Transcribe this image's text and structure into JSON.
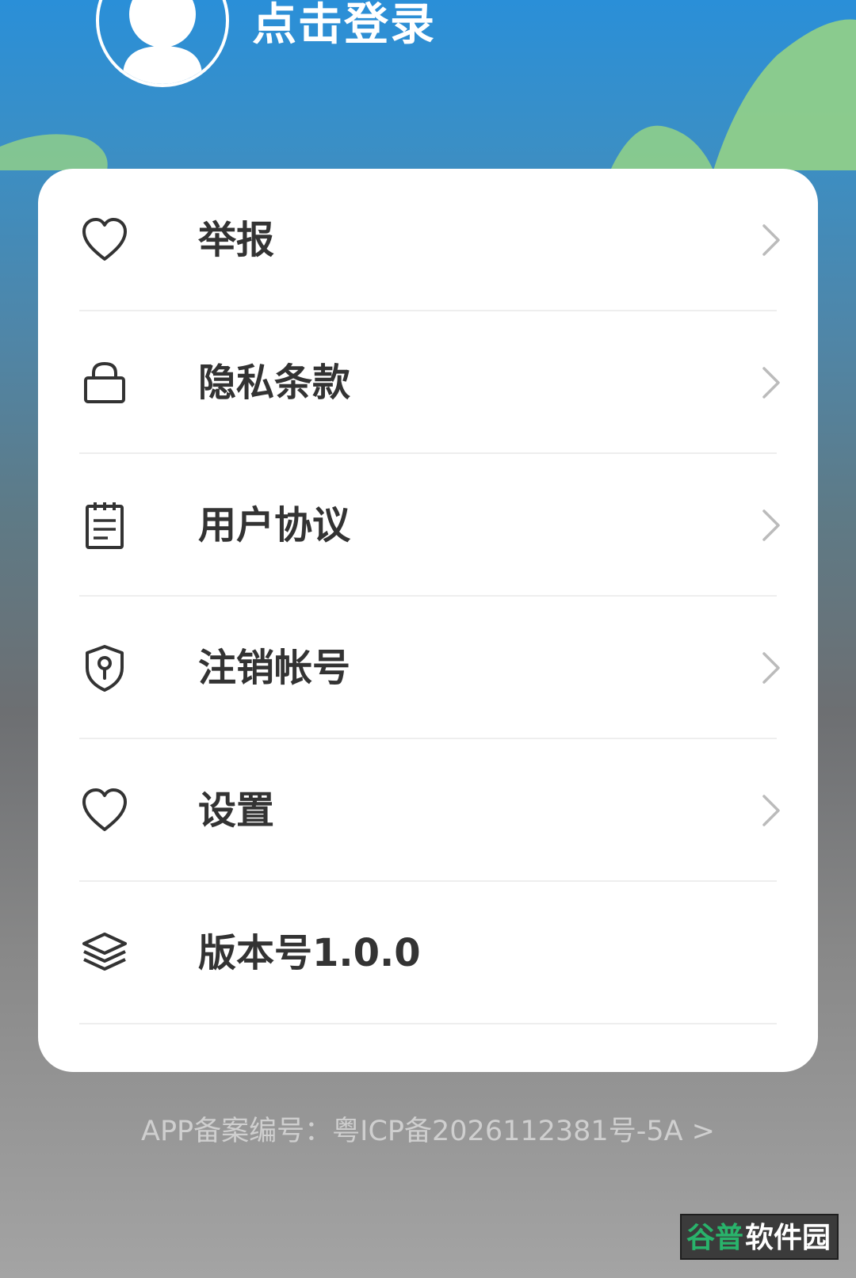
{
  "header": {
    "login_label": "点击登录"
  },
  "menu": {
    "items": [
      {
        "label": "举报",
        "icon": "heart-icon",
        "has_chevron": true
      },
      {
        "label": "隐私条款",
        "icon": "lock-icon",
        "has_chevron": true
      },
      {
        "label": "用户协议",
        "icon": "notepad-icon",
        "has_chevron": true
      },
      {
        "label": "注销帐号",
        "icon": "shield-keyhole-icon",
        "has_chevron": true
      },
      {
        "label": "设置",
        "icon": "heart-icon",
        "has_chevron": true
      },
      {
        "label": "版本号1.0.0",
        "icon": "layers-icon",
        "has_chevron": false
      }
    ]
  },
  "footer": {
    "icp_text": "APP备案编号：粤ICP备2026112381号-5A >"
  },
  "watermark": {
    "text": "谷普软件园"
  },
  "colors": {
    "accent": "#2a8fd8",
    "hill_green": "#8fcf8a",
    "text_primary": "#333333",
    "text_muted": "#cfcfcf",
    "chevron": "#bbbbbb"
  }
}
